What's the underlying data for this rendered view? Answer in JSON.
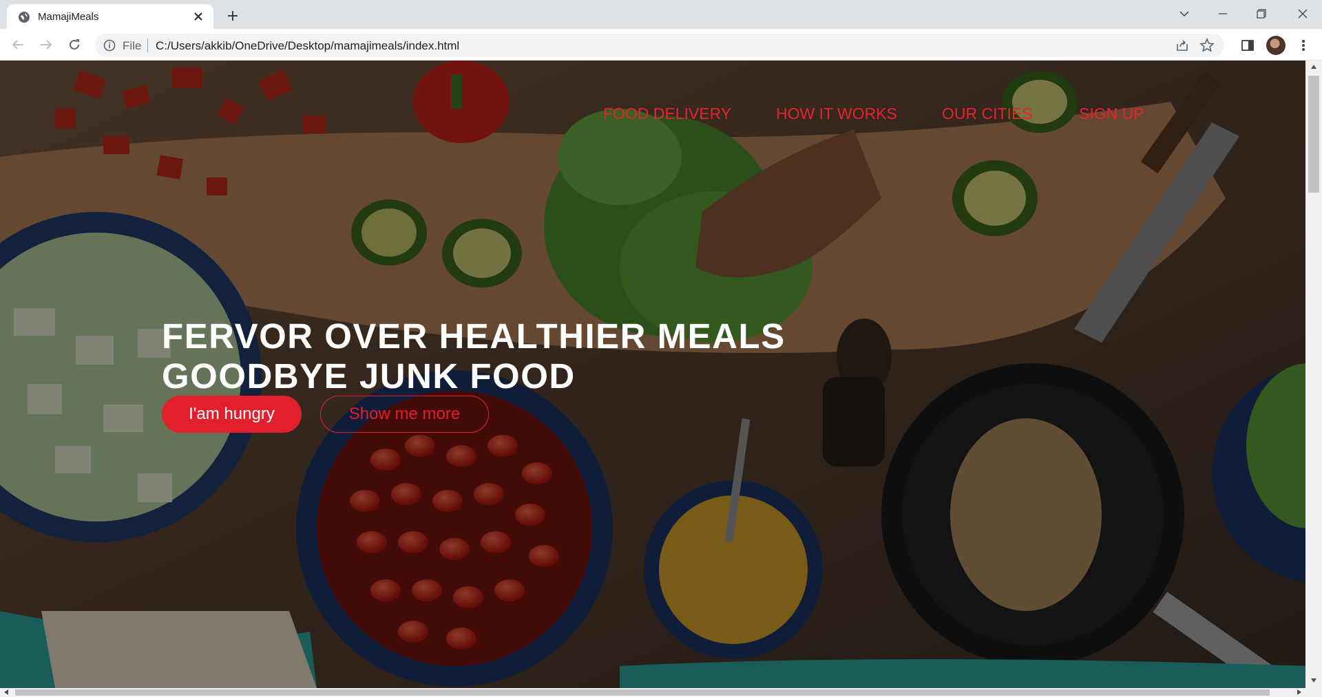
{
  "browser": {
    "tab_title": "MamajiMeals",
    "address_scheme": "File",
    "address_url": "C:/Users/akkib/OneDrive/Desktop/mamajimeals/index.html"
  },
  "nav": {
    "items": [
      {
        "label": "FOOD DELIVERY"
      },
      {
        "label": "HOW IT WORKS"
      },
      {
        "label": "OUR CITIES"
      },
      {
        "label": "SIGN UP"
      }
    ]
  },
  "hero": {
    "headline_line1": "FERVOR OVER HEALTHIER MEALS",
    "headline_line2": "GOODBYE JUNK FOOD",
    "primary_button": "I'am hungry",
    "secondary_button": "Show me more"
  },
  "colors": {
    "accent": "#e21f2c",
    "nav_link": "#e4242f"
  }
}
